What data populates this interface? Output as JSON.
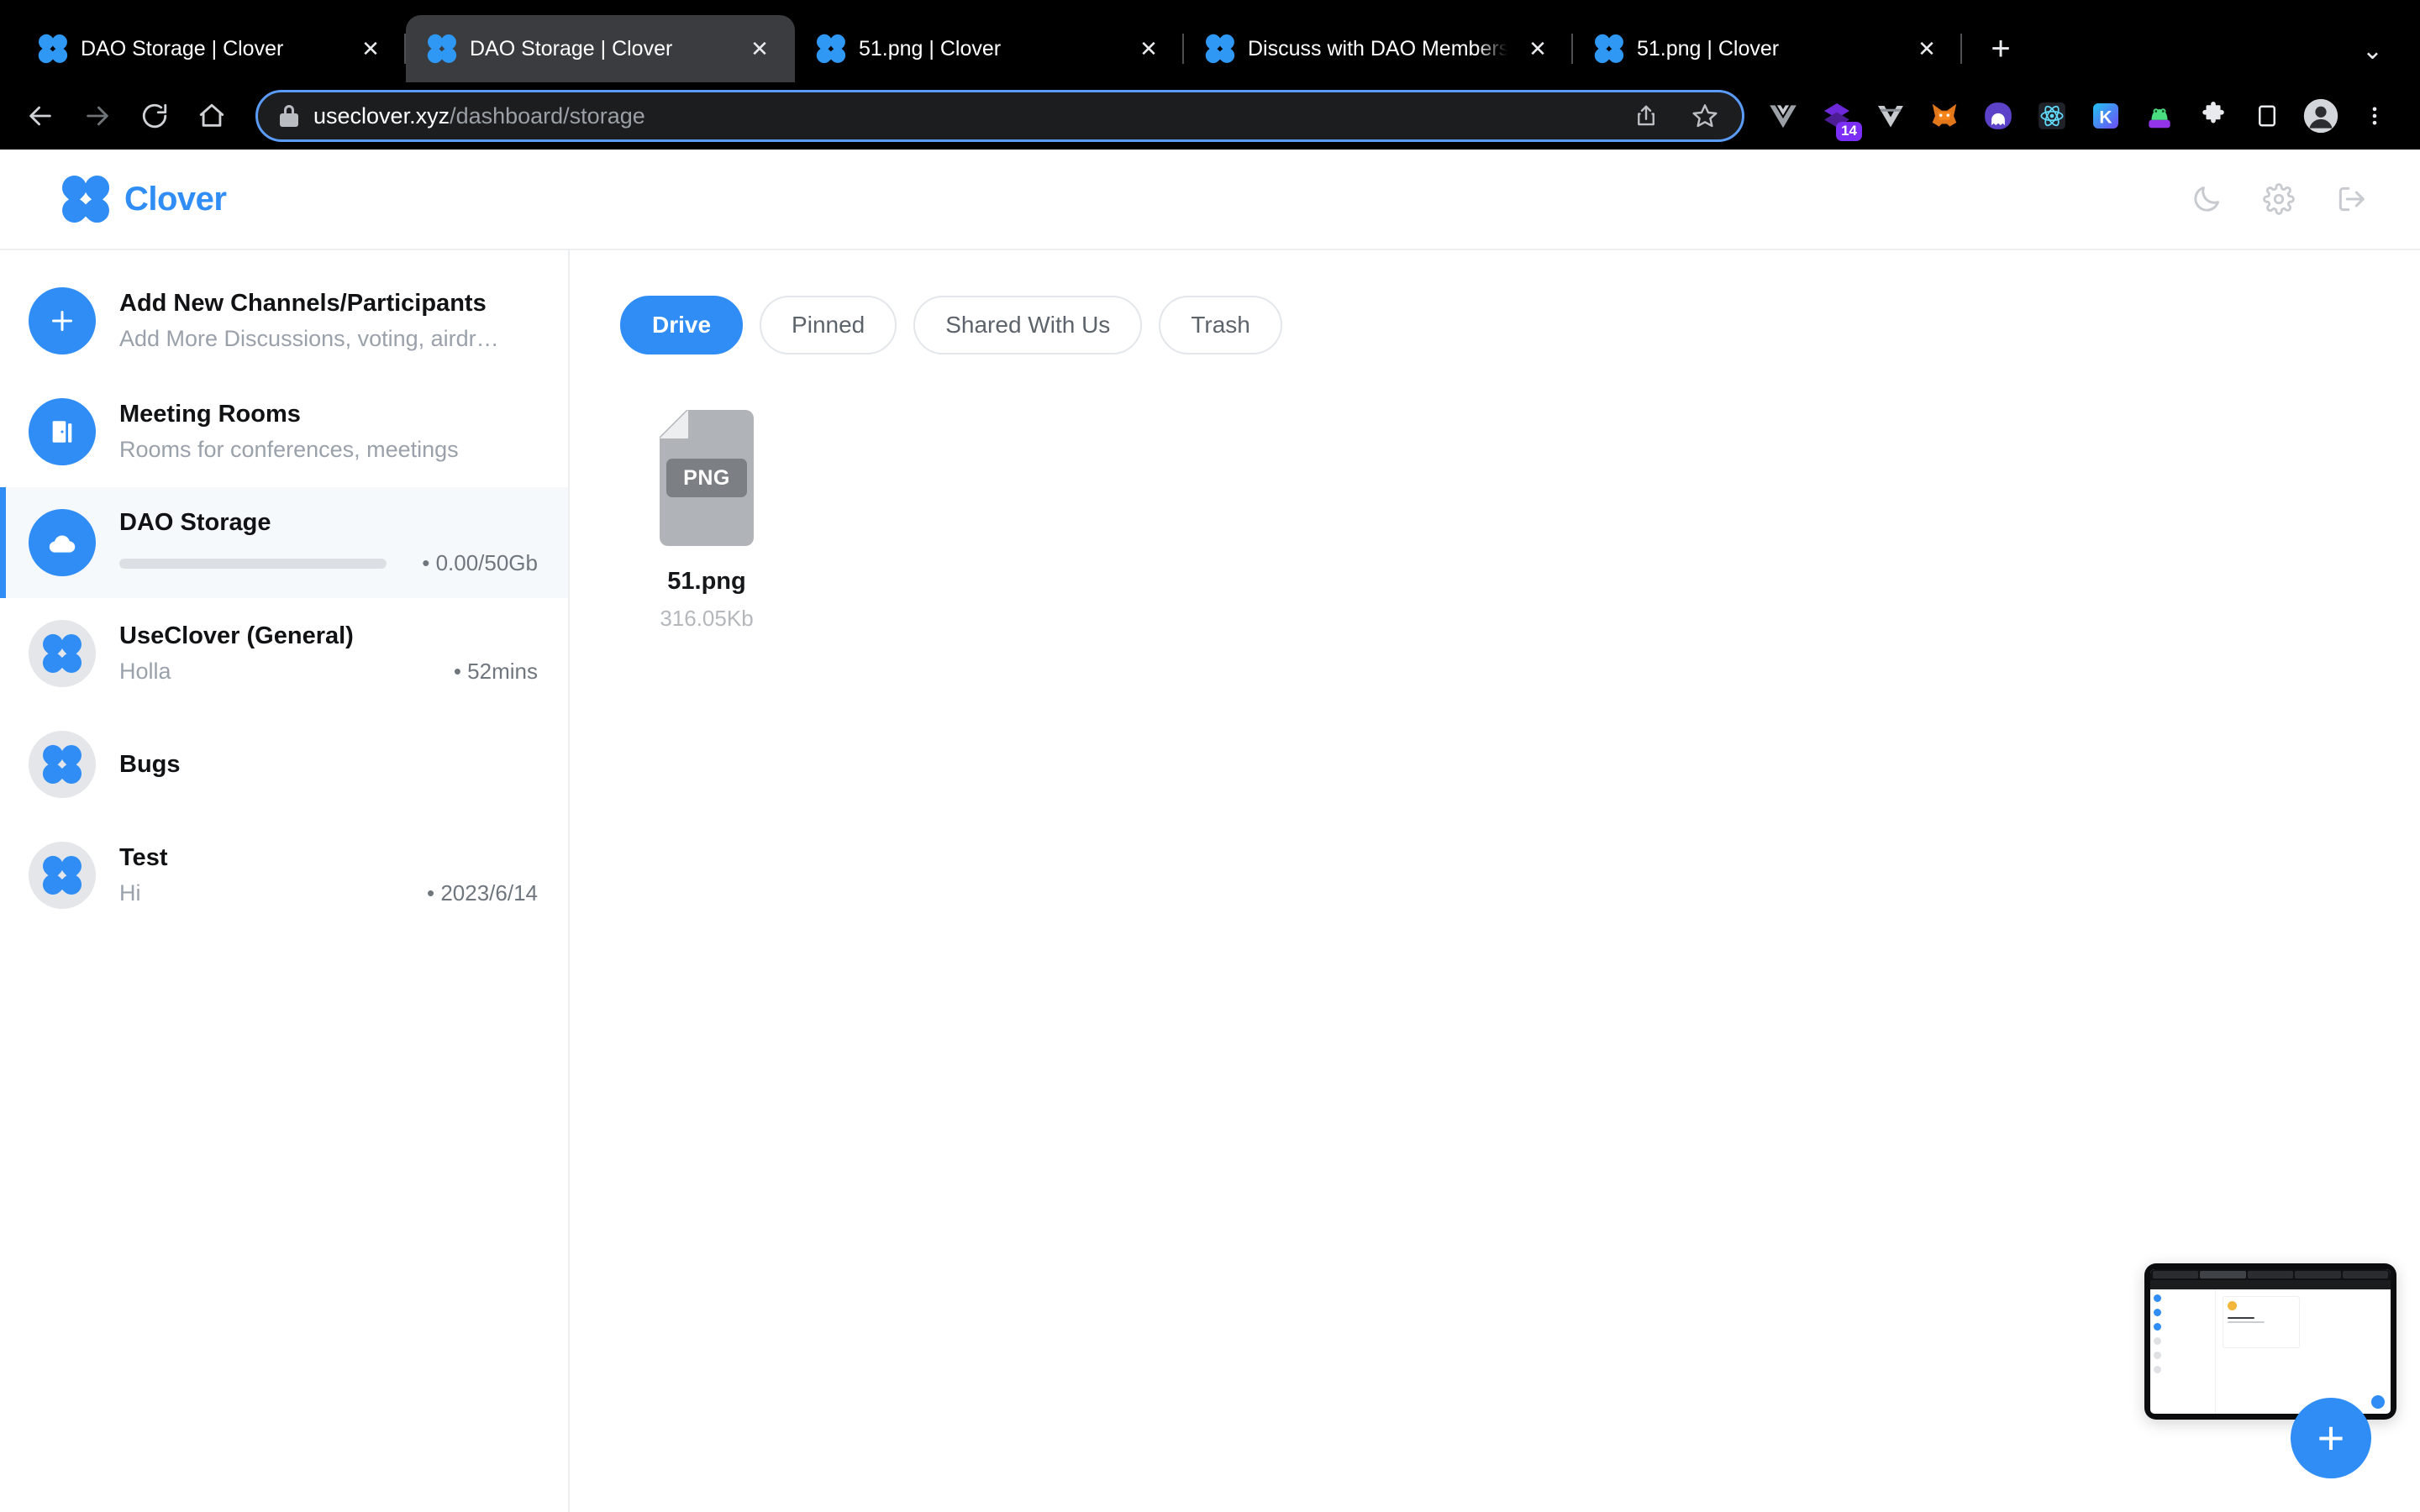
{
  "browser": {
    "tabs": [
      {
        "title": "DAO Storage | Clover",
        "active": false
      },
      {
        "title": "DAO Storage | Clover",
        "active": true
      },
      {
        "title": "51.png | Clover",
        "active": false
      },
      {
        "title": "Discuss with DAO Members | C",
        "active": false
      },
      {
        "title": "51.png | Clover",
        "active": false
      }
    ],
    "tab_close_label": "✕",
    "new_tab_label": "+",
    "tab_list_caret": "⌄",
    "nav": {
      "back": "back-arrow",
      "forward": "forward-arrow",
      "reload": "reload",
      "home": "home"
    },
    "url": {
      "host": "useclover.xyz",
      "path": "/dashboard/storage"
    },
    "omnibox_icons": [
      "share-icon",
      "bookmark-star-icon"
    ],
    "extensions": [
      {
        "name": "vue-devtools",
        "badge": ""
      },
      {
        "name": "purple-layers",
        "badge": "14"
      },
      {
        "name": "vite",
        "badge": ""
      },
      {
        "name": "metamask-fox",
        "badge": ""
      },
      {
        "name": "phantom-ghost",
        "badge": ""
      },
      {
        "name": "react-devtools",
        "badge": ""
      },
      {
        "name": "kredeum-k",
        "badge": ""
      },
      {
        "name": "frog",
        "badge": ""
      },
      {
        "name": "extensions-puzzle",
        "badge": ""
      },
      {
        "name": "side-panel",
        "badge": ""
      },
      {
        "name": "profile-avatar",
        "badge": ""
      },
      {
        "name": "chrome-menu",
        "badge": ""
      }
    ]
  },
  "app": {
    "brand": "Clover",
    "header_actions": [
      {
        "name": "dark-mode-toggle",
        "icon": "moon-icon"
      },
      {
        "name": "settings",
        "icon": "gear-icon"
      },
      {
        "name": "logout",
        "icon": "logout-icon"
      }
    ]
  },
  "sidebar": {
    "items": [
      {
        "title": "Add New Channels/Participants",
        "subtitle": "Add More Discussions, voting, airdr…",
        "icon": "plus-icon",
        "avatar": "blue",
        "meta": "",
        "active": false,
        "progress": null
      },
      {
        "title": "Meeting Rooms",
        "subtitle": "Rooms for conferences, meetings",
        "icon": "door-icon",
        "avatar": "blue",
        "meta": "",
        "active": false,
        "progress": null
      },
      {
        "title": "DAO Storage",
        "subtitle": "",
        "icon": "cloud-icon",
        "avatar": "blue",
        "meta": "0.00/50Gb",
        "active": true,
        "progress": 0
      },
      {
        "title": "UseClover (General)",
        "subtitle": "Holla",
        "icon": "clover-icon",
        "avatar": "grey",
        "meta": "52mins",
        "active": false,
        "progress": null
      },
      {
        "title": "Bugs",
        "subtitle": "",
        "icon": "clover-icon",
        "avatar": "grey",
        "meta": "",
        "active": false,
        "progress": null
      },
      {
        "title": "Test",
        "subtitle": "Hi",
        "icon": "clover-icon",
        "avatar": "grey",
        "meta": "2023/6/14",
        "active": false,
        "progress": null
      }
    ]
  },
  "main": {
    "tabs": [
      {
        "label": "Drive",
        "active": true
      },
      {
        "label": "Pinned",
        "active": false
      },
      {
        "label": "Shared With Us",
        "active": false
      },
      {
        "label": "Trash",
        "active": false
      }
    ],
    "files": [
      {
        "name": "51.png",
        "size": "316.05Kb",
        "type": "PNG"
      }
    ],
    "fab_label": "+"
  },
  "colors": {
    "accent": "#2f8df5",
    "chrome_bg": "#000000",
    "active_tab_bg": "#3a3c3f",
    "omnibox_focus": "#5a9cf8",
    "sidebar_active_bg": "#f6f9fc",
    "muted_text": "#9aa1aa"
  }
}
